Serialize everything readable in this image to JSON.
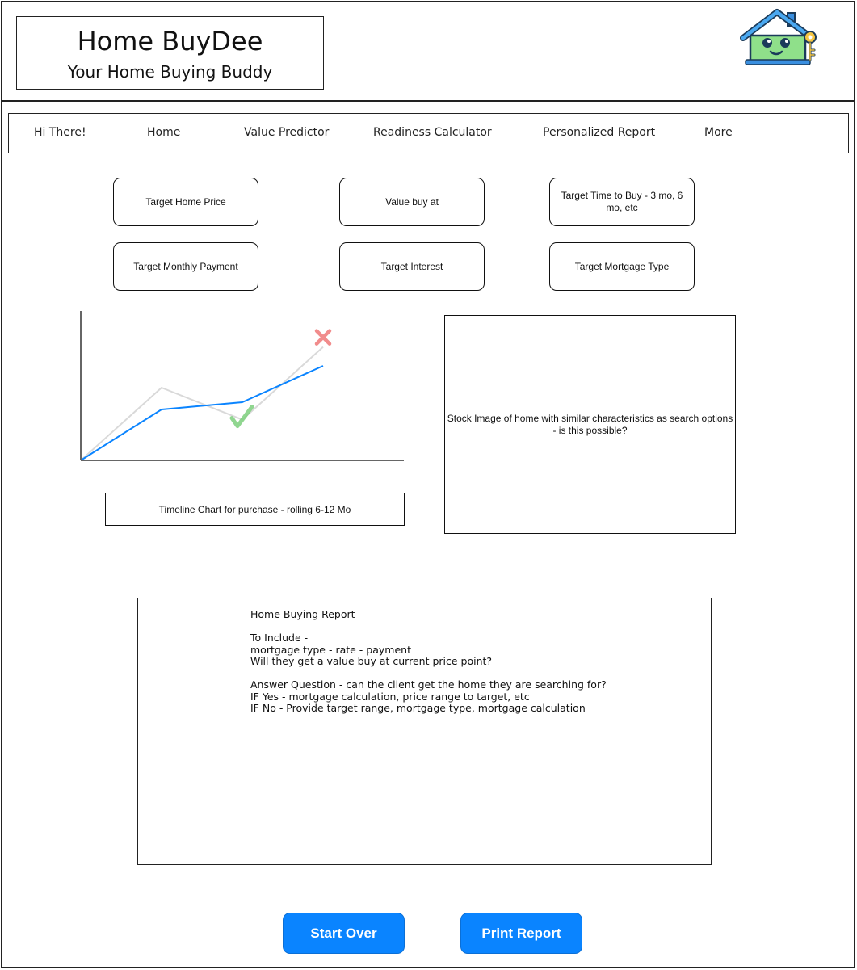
{
  "header": {
    "title": "Home BuyDee",
    "subtitle": "Your Home Buying Buddy",
    "logo_icon": "house-with-key-icon"
  },
  "nav": {
    "items": [
      {
        "label": "Hi There!"
      },
      {
        "label": "Home"
      },
      {
        "label": "Value Predictor"
      },
      {
        "label": "Readiness Calculator"
      },
      {
        "label": "Personalized Report"
      },
      {
        "label": "More"
      }
    ]
  },
  "options": {
    "target_home_price": "Target Home Price",
    "value_buy_at": "Value buy at",
    "target_time_to_buy": "Target Time to Buy - 3 mo, 6 mo, etc",
    "target_monthly_payment": "Target Monthly Payment",
    "target_interest": "Target Interest",
    "target_mortgage_type": "Target Mortgage Type"
  },
  "chart": {
    "caption": "Timeline Chart for purchase - rolling 6-12 Mo",
    "check_icon": "check-mark-icon",
    "x_icon": "x-mark-icon",
    "colors": {
      "primary_series": "#0a84ff",
      "secondary_series": "#d9d9d9",
      "axis": "#666666",
      "check": "#7ccf7c",
      "x_mark": "#f08080"
    }
  },
  "chart_data": {
    "type": "line",
    "x": [
      0,
      1,
      2,
      3
    ],
    "series": [
      {
        "values": [
          0,
          35,
          40,
          65
        ],
        "color": "#0a84ff"
      },
      {
        "values": [
          0,
          50,
          28,
          78
        ],
        "color": "#d9d9d9"
      }
    ],
    "markers": [
      {
        "series": 1,
        "point": 2,
        "icon": "check-mark-icon"
      },
      {
        "series": 1,
        "point": 3,
        "icon": "x-mark-icon"
      }
    ],
    "xlim": [
      0,
      4
    ],
    "ylim": [
      0,
      100
    ],
    "title": "",
    "xlabel": "",
    "ylabel": "",
    "grid": false
  },
  "stock_image": {
    "text": "Stock Image of home with similar characteristics as search options - is this possible?"
  },
  "report": {
    "lines": "Home Buying Report -\n\nTo Include -\nmortgage type - rate - payment\nWill they get a value buy at current price point?\n\nAnswer Question - can the client get the home they are searching for?\nIF Yes - mortgage calculation, price range to target, etc\nIF No - Provide target range, mortgage type, mortgage calculation"
  },
  "actions": {
    "start_over": "Start Over",
    "print_report": "Print Report",
    "button_color": "#0a84ff"
  }
}
